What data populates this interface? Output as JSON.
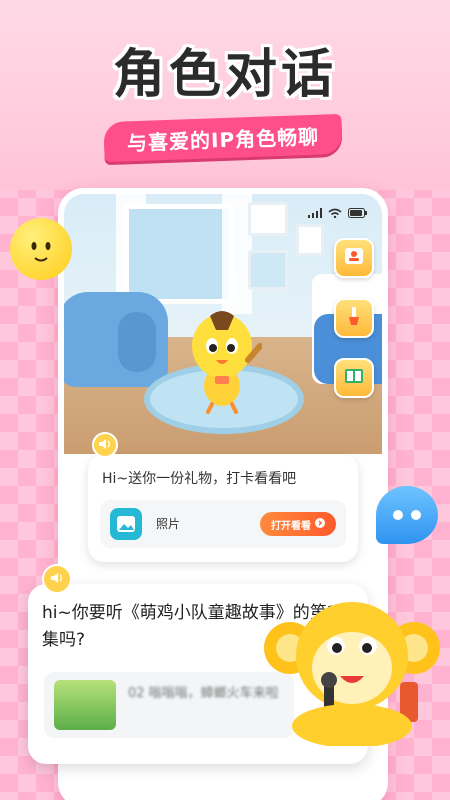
{
  "header": {
    "title": "角色对话",
    "subtitle": "与喜爱的IP角色畅聊"
  },
  "room": {
    "status_time": "",
    "side_buttons": [
      {
        "icon": "contact-card-icon"
      },
      {
        "icon": "paint-brush-icon"
      },
      {
        "icon": "storybook-icon"
      }
    ]
  },
  "message": {
    "text": "Hi~送你一份礼物，打卡看看吧",
    "gift_label": "照片",
    "open_button": "打开看看"
  },
  "story": {
    "text": "hi~你要听《萌鸡小队童趣故事》的第2集吗?",
    "item_text": "02 嗡嗡嗡，蟑螂火车来啦"
  },
  "colors": {
    "accent": "#ff4f8a",
    "button": "#ff6a2f",
    "chat_bubble": "#2e93f0"
  }
}
